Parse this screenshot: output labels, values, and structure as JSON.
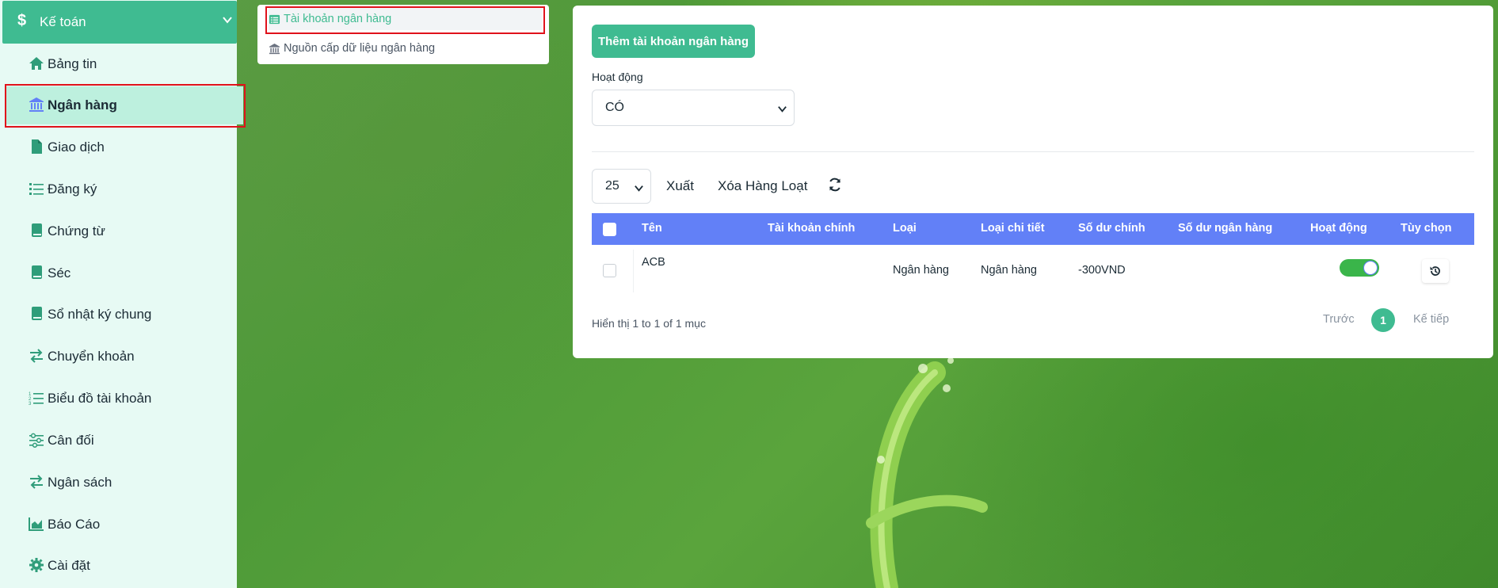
{
  "colors": {
    "accent": "#3fbb91",
    "table_header": "#6280f7",
    "sidebar_bg": "#e7faf4",
    "active_item_bg": "#bdf0de",
    "highlight": "#e0121b",
    "toggle_on": "#3ab54a"
  },
  "sidebar": {
    "header": {
      "icon": "dollar-icon",
      "label": "Kế toán"
    },
    "items": [
      {
        "icon": "home-icon",
        "label": "Bảng tin"
      },
      {
        "icon": "bank-icon",
        "label": "Ngân hàng",
        "active": true
      },
      {
        "icon": "file-icon",
        "label": "Giao dịch"
      },
      {
        "icon": "list-icon",
        "label": "Đăng ký"
      },
      {
        "icon": "book-icon",
        "label": "Chứng từ"
      },
      {
        "icon": "book-icon",
        "label": "Séc"
      },
      {
        "icon": "book-icon",
        "label": "Sổ nhật ký chung"
      },
      {
        "icon": "transfer-icon",
        "label": "Chuyển khoản"
      },
      {
        "icon": "ordered-list-icon",
        "label": "Biểu đồ tài khoản"
      },
      {
        "icon": "sliders-icon",
        "label": "Cân đối"
      },
      {
        "icon": "transfer-icon",
        "label": "Ngân sách"
      },
      {
        "icon": "area-chart-icon",
        "label": "Báo Cáo"
      },
      {
        "icon": "gear-icon",
        "label": "Cài đặt"
      }
    ]
  },
  "submenu": {
    "items": [
      {
        "icon": "list-icon",
        "label": "Tài khoản ngân hàng",
        "active": true
      },
      {
        "icon": "bank-icon",
        "label": "Nguồn cấp dữ liệu ngân hàng"
      }
    ]
  },
  "main": {
    "add_button": "Thêm tài khoản ngân hàng",
    "filter_label": "Hoạt động",
    "filter_value": "CÓ",
    "page_length": "25",
    "export_label": "Xuất",
    "bulk_delete_label": "Xóa Hàng Loạt",
    "table": {
      "headers": [
        "Tên",
        "Tài khoản chính",
        "Loại",
        "Loại chi tiết",
        "Số dư chính",
        "Số dư ngân hàng",
        "Hoạt động",
        "Tùy chọn"
      ],
      "rows": [
        {
          "name": "ACB",
          "parent_account": "",
          "type": "Ngân hàng",
          "detail_type": "Ngân hàng",
          "primary_balance": "-300VND",
          "bank_balance": "",
          "active": true
        }
      ]
    },
    "info": "Hiển thị 1 to 1 of 1 mục",
    "pagination": {
      "prev": "Trước",
      "current": "1",
      "next": "Kế tiếp"
    }
  }
}
